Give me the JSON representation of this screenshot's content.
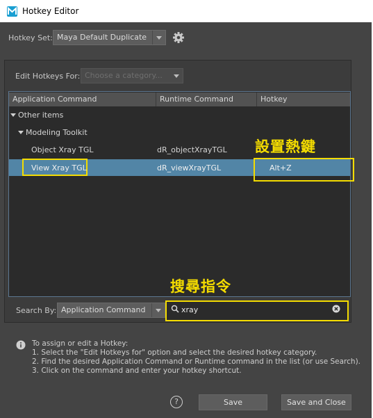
{
  "window": {
    "title": "Hotkey Editor"
  },
  "hotkey_set": {
    "label": "Hotkey Set:",
    "value": "Maya Default Duplicate"
  },
  "edit_for": {
    "label": "Edit Hotkeys For:",
    "placeholder": "Choose a category..."
  },
  "table": {
    "headers": [
      "Application Command",
      "Runtime Command",
      "Hotkey"
    ],
    "groups": {
      "other": "Other items",
      "modeling": "Modeling Toolkit"
    },
    "rows": [
      {
        "app": "Object Xray TGL",
        "runtime": "dR_objectXrayTGL",
        "hotkey": ""
      },
      {
        "app": "View Xray TGL",
        "runtime": "dR_viewXrayTGL",
        "hotkey": "Alt+Z"
      }
    ]
  },
  "annotations": {
    "set_hotkey": "設置熱鍵",
    "search_command": "搜尋指令"
  },
  "search": {
    "label": "Search By:",
    "mode": "Application Command",
    "value": "xray"
  },
  "help": {
    "intro": "To assign or edit a Hotkey:",
    "steps": [
      "1. Select the \"Edit Hotkeys for\" option and select the desired hotkey category.",
      "2. Find the desired Application Command or Runtime command in the list (or use Search).",
      "3. Click on the command and enter your hotkey shortcut."
    ]
  },
  "buttons": {
    "help": "?",
    "save": "Save",
    "save_close": "Save and Close"
  },
  "icons": {
    "app": "maya-app-icon",
    "settings": "gear-icon",
    "search": "search-icon",
    "clear": "clear-icon",
    "info": "info-icon"
  },
  "colors": {
    "background": "#444444",
    "selection": "#5285a6",
    "annotation": "#f4dc00"
  }
}
